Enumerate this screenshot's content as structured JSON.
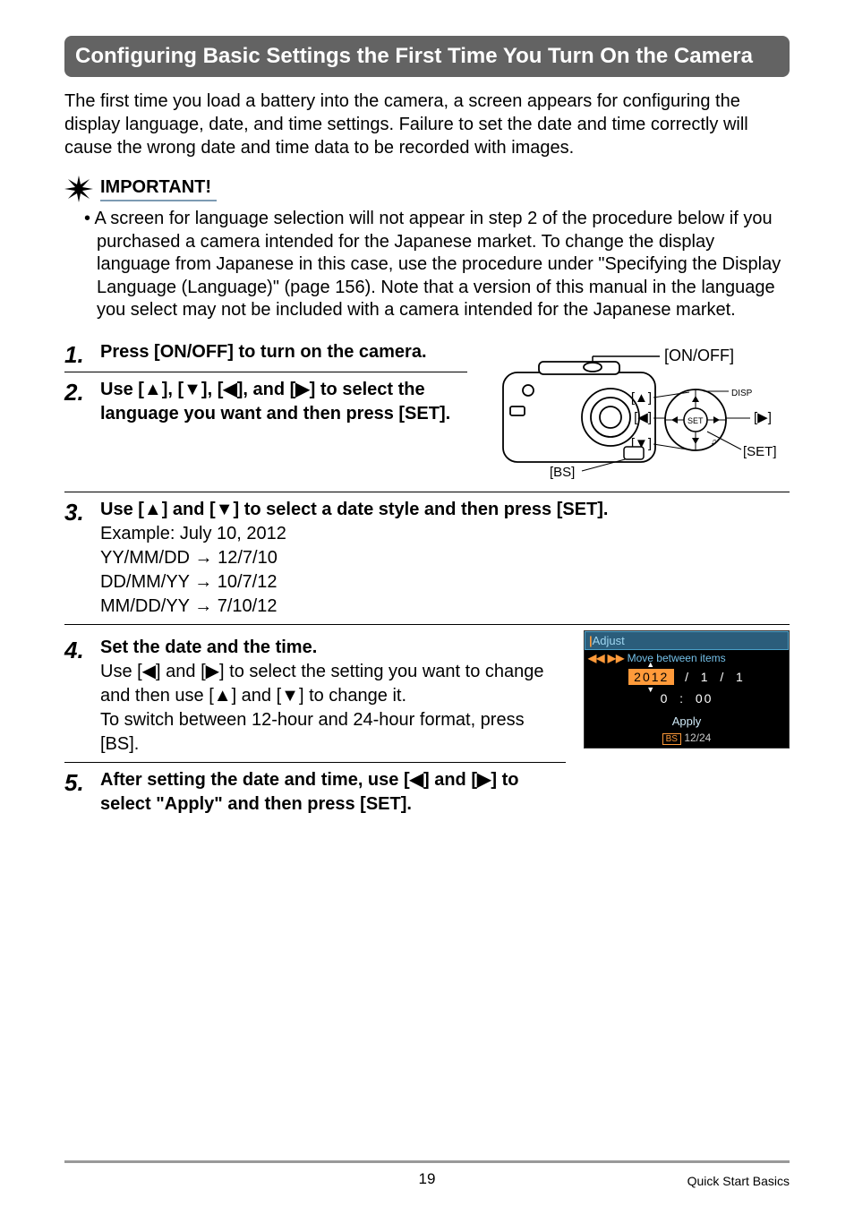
{
  "heading": "Configuring Basic Settings the First Time You Turn On the Camera",
  "intro": "The first time you load a battery into the camera, a screen appears for configuring the display language, date, and time settings. Failure to set the date and time correctly will cause the wrong date and time data to be recorded with images.",
  "important": {
    "label": "IMPORTANT!",
    "body": "• A screen for language selection will not appear in step 2 of the procedure below if you purchased a camera intended for the Japanese market. To change the display language from Japanese in this case, use the procedure under \"Specifying the Display Language (Language)\" (page 156). Note that a version of this manual in the language you select may not be included with a camera intended for the Japanese market."
  },
  "diagram_labels": {
    "onoff": "[ON/OFF]",
    "up": "[▲]",
    "down": "[▼]",
    "left": "[◀]",
    "right": "[▶]",
    "set": "[SET]",
    "bs": "[BS]",
    "disp": "DISP"
  },
  "steps": [
    {
      "num": "1.",
      "title": "Press [ON/OFF] to turn on the camera."
    },
    {
      "num": "2.",
      "title": "Use [▲], [▼], [◀], and [▶] to select the language you want and then press [SET]."
    },
    {
      "num": "3.",
      "title": "Use [▲] and [▼] to select a date style and then press [SET].",
      "body_lines": [
        "Example: July 10, 2012",
        "YY/MM/DD → 12/7/10",
        "DD/MM/YY → 10/7/12",
        "MM/DD/YY → 7/10/12"
      ]
    },
    {
      "num": "4.",
      "title": "Set the date and the time.",
      "body_lines": [
        "Use [◀] and [▶] to select the setting you want to change and then use [▲] and [▼] to change it.",
        "To switch between 12-hour and 24-hour format, press [BS]."
      ]
    },
    {
      "num": "5.",
      "title": "After setting the date and time, use [◀] and [▶] to select \"Apply\" and then press [SET]."
    }
  ],
  "adjust_screen": {
    "title": "Adjust",
    "subtitle": "Move between items",
    "year": "2012",
    "month": "1",
    "day": "1",
    "hour": "0",
    "minute": "00",
    "apply": "Apply",
    "mode": "12/24",
    "bs_label": "BS"
  },
  "footer": {
    "page": "19",
    "section": "Quick Start Basics"
  }
}
